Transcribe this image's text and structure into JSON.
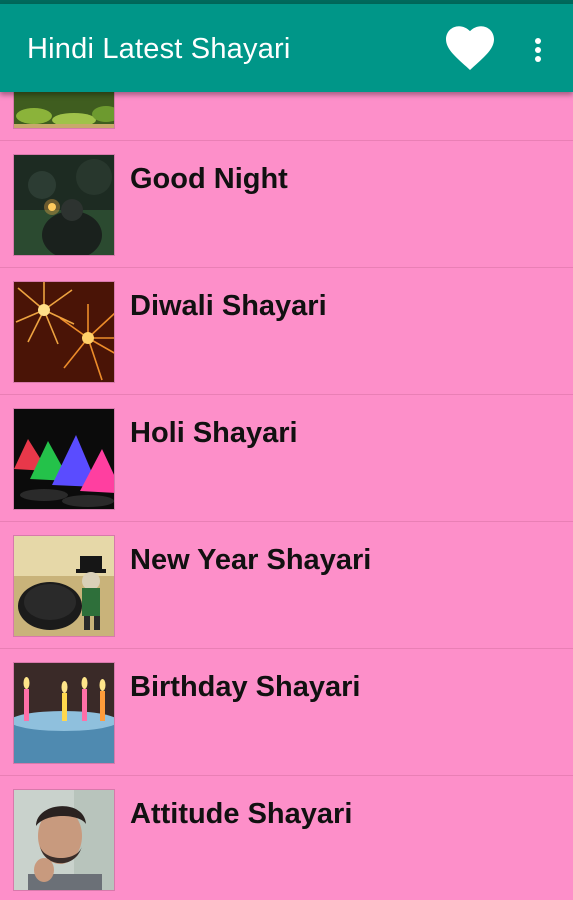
{
  "app": {
    "title": "Hindi Latest Shayari",
    "favorite_icon": "heart-icon",
    "menu_icon": "more-vert-icon",
    "colors": {
      "toolbar": "#009688",
      "status_bar": "#00695c",
      "background": "#fd8fc9"
    }
  },
  "categories": [
    {
      "label": "",
      "thumbnail": "garden-image"
    },
    {
      "label": "Good Night",
      "thumbnail": "night-candle-image"
    },
    {
      "label": "Diwali Shayari",
      "thumbnail": "fireworks-image"
    },
    {
      "label": "Holi Shayari",
      "thumbnail": "color-powder-image"
    },
    {
      "label": "New Year Shayari",
      "thumbnail": "new-year-hat-image"
    },
    {
      "label": "Birthday Shayari",
      "thumbnail": "birthday-candles-image"
    },
    {
      "label": "Attitude Shayari",
      "thumbnail": "man-portrait-image"
    }
  ]
}
